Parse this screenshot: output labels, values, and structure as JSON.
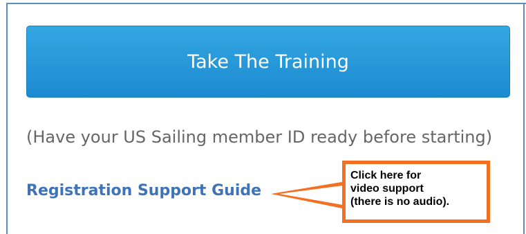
{
  "training_button": {
    "label": "Take The Training"
  },
  "member_note": "(Have your US Sailing member ID ready before starting)",
  "support_link": {
    "label": "Registration Support Guide"
  },
  "callout": {
    "lines": [
      "Click here for",
      "video support",
      "(there is no audio)."
    ],
    "border_color": "#f36f21"
  },
  "colors": {
    "button_blue": "#2a9bdc",
    "link_blue": "#3f73b8",
    "note_gray": "#666666"
  }
}
